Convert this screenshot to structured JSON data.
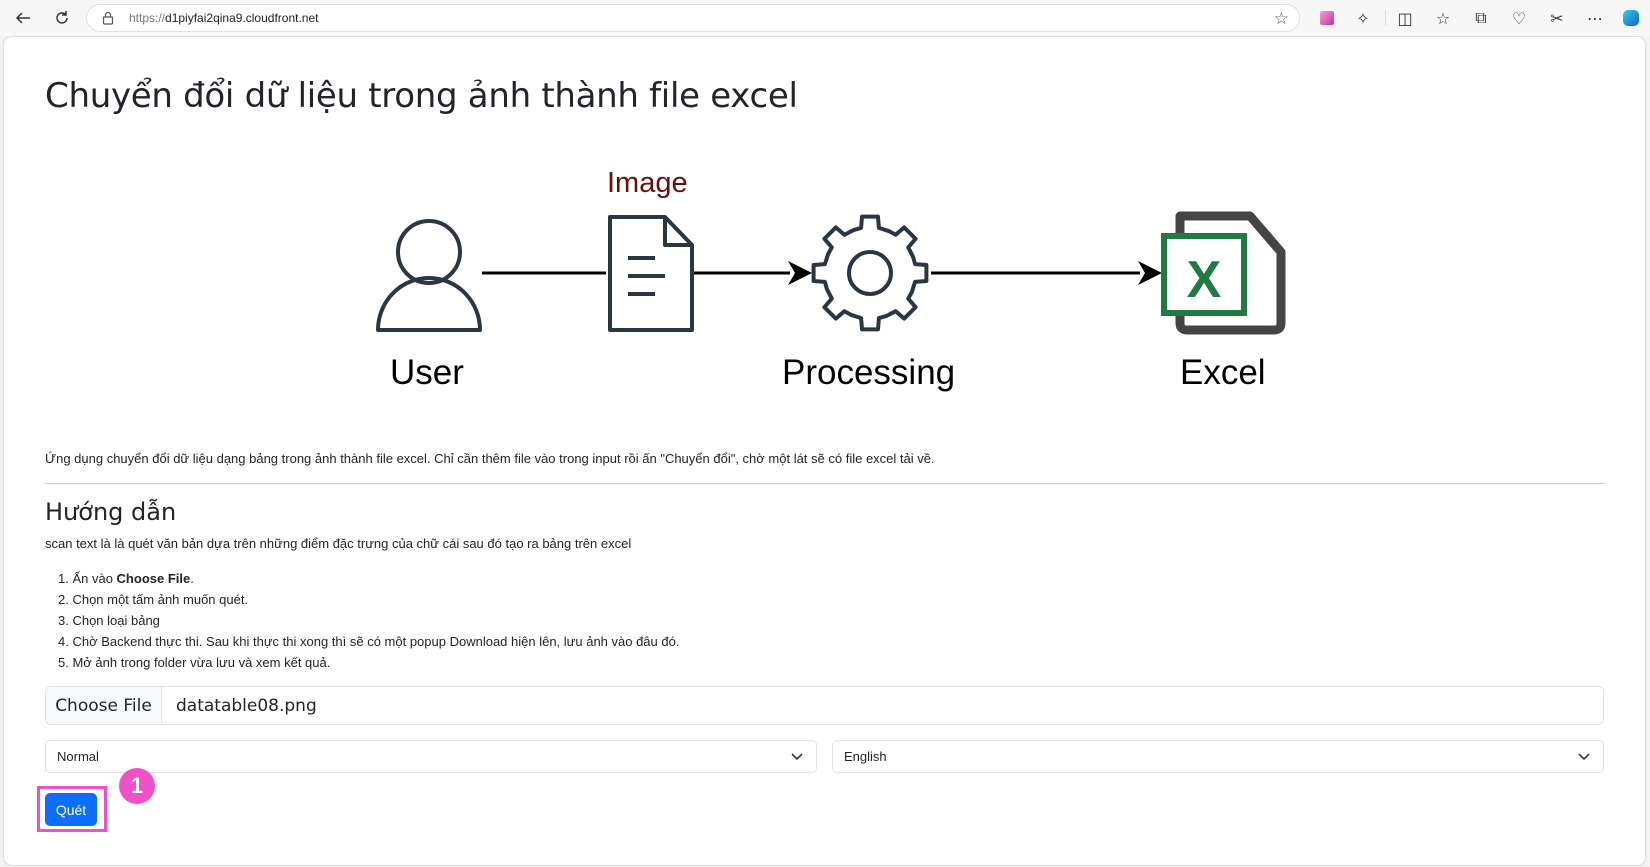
{
  "browser": {
    "url_scheme": "https://",
    "url_host": "d1piyfai2qina9.cloudfront.net",
    "icons": [
      "back-icon",
      "refresh-icon",
      "lock-icon",
      "favorite-star-icon",
      "profile-color-icon",
      "extensions-icon",
      "split-screen-icon",
      "favorites-icon",
      "collections-icon",
      "browser-essentials-icon",
      "screenshot-icon",
      "more-icon",
      "copilot-icon"
    ]
  },
  "page": {
    "title": "Chuyển đổi dữ liệu trong ảnh thành file excel",
    "diagram": {
      "image_label": "Image",
      "user_label": "User",
      "processing_label": "Processing",
      "excel_label": "Excel"
    },
    "description": "Ứng dụng chuyển đổi dữ liệu dạng bảng trong ảnh thành file excel. Chỉ cần thêm file vào trong input rồi ấn \"Chuyển đổi\", chờ một lát sẽ có file excel tải về.",
    "guide_heading": "Hướng dẫn",
    "guide_intro": "scan text là là quét văn bản dựa trên những điểm đặc trưng của chữ cái sau đó tạo ra bảng trên excel",
    "steps": [
      {
        "prefix": "1. Ấn vào ",
        "bold": "Choose File",
        "suffix": "."
      },
      {
        "text": "2. Chọn một tấm ảnh muốn quét."
      },
      {
        "text": "3. Chọn loại bảng"
      },
      {
        "text": "4. Chờ Backend thực thi. Sau khi thực thi xong thì sẽ có một popup Download hiện lên, lưu ảnh vào đâu đó."
      },
      {
        "text": "5. Mở ảnh trong folder vừa lưu và xem kết quả."
      }
    ],
    "file_input": {
      "button_label": "Choose File",
      "file_name": "datatable08.png"
    },
    "table_type_select": {
      "value": "Normal"
    },
    "language_select": {
      "value": "English"
    },
    "scan_button_label": "Quét",
    "annotation_number": "1"
  },
  "colors": {
    "primary": "#0d6efd",
    "annotation": "#f050c8",
    "image_label": "#6b0c0c",
    "excel_green": "#1f7a43"
  }
}
